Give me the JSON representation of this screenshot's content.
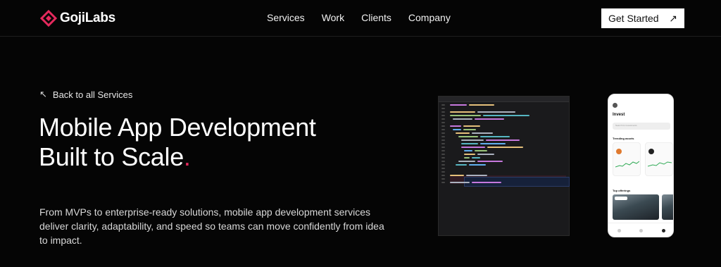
{
  "brand": {
    "name_part1": "Goji",
    "name_part2": "Labs",
    "accent_color": "#e5295d"
  },
  "nav": {
    "links": [
      "Services",
      "Work",
      "Clients",
      "Company"
    ],
    "cta_label": "Get Started",
    "cta_icon": "arrow-up-right-icon"
  },
  "hero": {
    "back_label": "Back to all Services",
    "back_icon": "arrow-up-left-icon",
    "title_line1": "Mobile App Development",
    "title_line2": "Built to Scale",
    "title_dot": ".",
    "description": "From MVPs to enterprise-ready solutions, mobile app development services deliver clarity, adaptability, and speed so teams can move confidently from idea to impact."
  },
  "phone_mock": {
    "title": "Invest",
    "search_placeholder": "Search for investments",
    "section_trending": "Trending assets",
    "section_top": "Top offerings"
  }
}
